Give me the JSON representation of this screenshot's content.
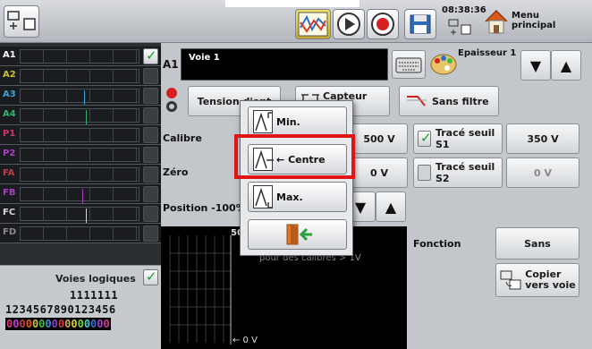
{
  "topbar": {
    "time": "08:38:36",
    "menu_label_1": "Menu",
    "menu_label_2": "principal"
  },
  "channels": [
    {
      "label": "A1",
      "color": "#ffffff",
      "checked": true
    },
    {
      "label": "A2",
      "color": "#c9c431",
      "checked": false
    },
    {
      "label": "A3",
      "color": "#3aa5d8",
      "checked": false
    },
    {
      "label": "A4",
      "color": "#2fb36a",
      "checked": false
    },
    {
      "label": "P1",
      "color": "#c9386a",
      "checked": false
    },
    {
      "label": "P2",
      "color": "#b03ec9",
      "checked": false
    },
    {
      "label": "FA",
      "color": "#c03a4a",
      "checked": false
    },
    {
      "label": "FB",
      "color": "#a63fc0",
      "checked": false
    },
    {
      "label": "FC",
      "color": "#d8d8d8",
      "checked": false
    },
    {
      "label": "FD",
      "color": "#8b8b8b",
      "checked": false
    }
  ],
  "logic": {
    "title": "Voies logiques",
    "digits_line1": "1111111",
    "digits_line2": "1234567890123456",
    "bits": "0000000000000000"
  },
  "main": {
    "channel_tag": "A1",
    "channel_name": "Voie 1",
    "thickness_label": "Epaisseur 1",
    "tension_label": "Tension d'ent",
    "capteur_label_1": "Capteur",
    "capteur_label_2": "e",
    "filter_label": "Sans filtre",
    "calibre_label": "Calibre",
    "calibre_value": "500 V",
    "trace_s1_label": "Tracé seuil S1",
    "trace_s1_value": "350 V",
    "zero_label": "Zéro",
    "zero_value": "0 V",
    "trace_s2_label": "Tracé seuil S2",
    "trace_s2_value": "0 V",
    "position_label": "Position -100%",
    "scope_top": "50",
    "scope_note": "pour des calibres > 1V",
    "scope_bottom": "← 0 V",
    "fonction_label": "Fonction",
    "fonction_value": "Sans",
    "copy_label_1": "Copier",
    "copy_label_2": "vers voie"
  },
  "popup": {
    "min_label": "Min.",
    "centre_label": "Centre",
    "max_label": "Max."
  }
}
